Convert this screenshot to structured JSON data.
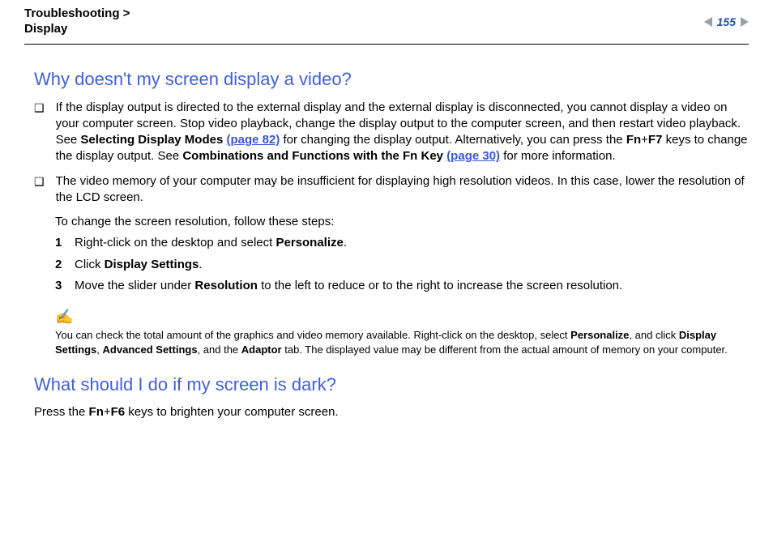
{
  "header": {
    "breadcrumb_l1": "Troubleshooting",
    "breadcrumb_sep": " > ",
    "breadcrumb_l2": "Display",
    "pageNumber": "155"
  },
  "s1": {
    "heading": "Why doesn't my screen display a video?",
    "b1_a": "If the display output is directed to the external display and the external display is disconnected, you cannot display a video on your computer screen. Stop video playback, change the display output to the computer screen, and then restart video playback. See ",
    "b1_link1a": "Selecting Display Modes ",
    "b1_link1b": "(page 82)",
    "b1_b": " for changing the display output. Alternatively, you can press the ",
    "b1_fn": "Fn",
    "b1_plus": "+",
    "b1_f7": "F7",
    "b1_c": " keys to change the display output. See ",
    "b1_link2a": "Combinations and Functions with the Fn Key ",
    "b1_link2b": "(page 30)",
    "b1_d": " for more information.",
    "b2": "The video memory of your computer may be insufficient for displaying high resolution videos. In this case, lower the resolution of the LCD screen.",
    "b2_sub": "To change the screen resolution, follow these steps:",
    "steps": {
      "s1a": "Right-click on the desktop and select ",
      "s1b": "Personalize",
      "s1c": ".",
      "s2a": "Click ",
      "s2b": "Display Settings",
      "s2c": ".",
      "s3a": "Move the slider under ",
      "s3b": "Resolution",
      "s3c": " to the left to reduce or to the right to increase the screen resolution."
    },
    "note_icon": "✍",
    "note_a": "You can check the total amount of the graphics and video memory available. Right-click on the desktop, select ",
    "note_b": "Personalize",
    "note_c": ", and click ",
    "note_d": "Display Settings",
    "note_e": ", ",
    "note_f": "Advanced Settings",
    "note_g": ", and the ",
    "note_h": "Adaptor",
    "note_i": " tab. The displayed value may be different from the actual amount of memory on your computer."
  },
  "s2": {
    "heading": "What should I do if my screen is dark?",
    "p_a": "Press the ",
    "p_fn": "Fn",
    "p_plus": "+",
    "p_f6": "F6",
    "p_b": " keys to brighten your computer screen."
  },
  "num": {
    "n1": "1",
    "n2": "2",
    "n3": "3"
  }
}
